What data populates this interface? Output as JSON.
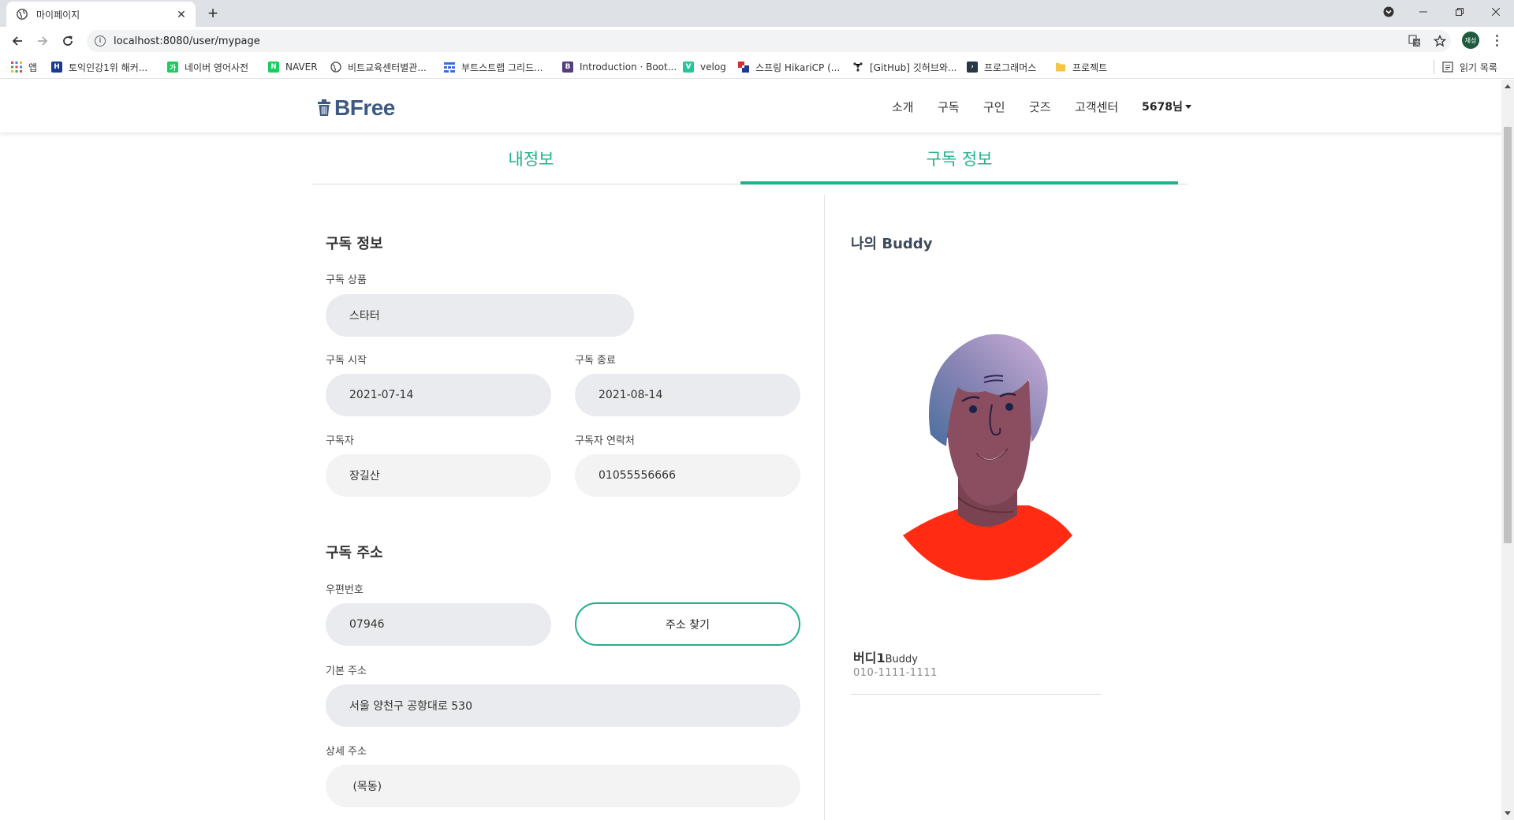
{
  "browser": {
    "tab_title": "마이페이지",
    "url": "localhost:8080/user/mypage",
    "profile_label": "재성",
    "bookmarks": [
      {
        "label": "앱",
        "icon": "apps-grid-icon",
        "color": "#e94235"
      },
      {
        "label": "토익인강1위 해커...",
        "icon": "hackers-h-icon",
        "color": "#1a3b8f"
      },
      {
        "label": "네이버 영어사전",
        "icon": "naver-dict-icon",
        "color": "#19ce60"
      },
      {
        "label": "NAVER",
        "icon": "naver-n-icon",
        "color": "#19ce60"
      },
      {
        "label": "비트교육센터별관...",
        "icon": "globe-icon",
        "color": "#5f6368"
      },
      {
        "label": "부트스트랩 그리드...",
        "icon": "grid-table-icon",
        "color": "#3b6fd6"
      },
      {
        "label": "Introduction · Boot...",
        "icon": "bootstrap-b-icon",
        "color": "#563d7c"
      },
      {
        "label": "velog",
        "icon": "velog-v-icon",
        "color": "#20c997"
      },
      {
        "label": "스프링 HikariCP (...",
        "icon": "tistory-icon",
        "color": "#d32f2f"
      },
      {
        "label": "[GitHub] 깃허브와...",
        "icon": "github-dots-icon",
        "color": "#333333"
      },
      {
        "label": "프로그래머스",
        "icon": "programmers-icon",
        "color": "#263747"
      },
      {
        "label": "프로젝트",
        "icon": "folder-icon",
        "color": "#f5c542"
      }
    ],
    "reading_list": "읽기 목록"
  },
  "header": {
    "logo": "BFree",
    "nav": [
      "소개",
      "구독",
      "구인",
      "굿즈",
      "고객센터"
    ],
    "user": "5678님"
  },
  "tabs": [
    {
      "label": "내정보",
      "active": false
    },
    {
      "label": "구독 정보",
      "active": true
    }
  ],
  "subscription": {
    "section_title": "구독 정보",
    "product_label": "구독 상품",
    "product_value": "스타터",
    "start_label": "구독 시작",
    "start_value": "2021-07-14",
    "end_label": "구독 종료",
    "end_value": "2021-08-14",
    "subscriber_label": "구독자",
    "subscriber_value": "장길산",
    "phone_label": "구독자 연락처",
    "phone_value": "01055556666"
  },
  "address": {
    "section_title": "구독 주소",
    "zip_label": "우편번호",
    "zip_value": "07946",
    "find_button": "주소 찾기",
    "base_label": "기본 주소",
    "base_value": "서울 양천구 공항대로 530",
    "detail_label": "상세 주소",
    "detail_value": " (목동)"
  },
  "buddy": {
    "title": "나의 Buddy",
    "name": "버디1",
    "name_suffix": "Buddy",
    "phone": "010-1111-1111"
  },
  "colors": {
    "accent": "#20b08d",
    "logo": "#3e5a82",
    "field_bg": "#e9ebee",
    "shirt": "#ff2b12"
  }
}
